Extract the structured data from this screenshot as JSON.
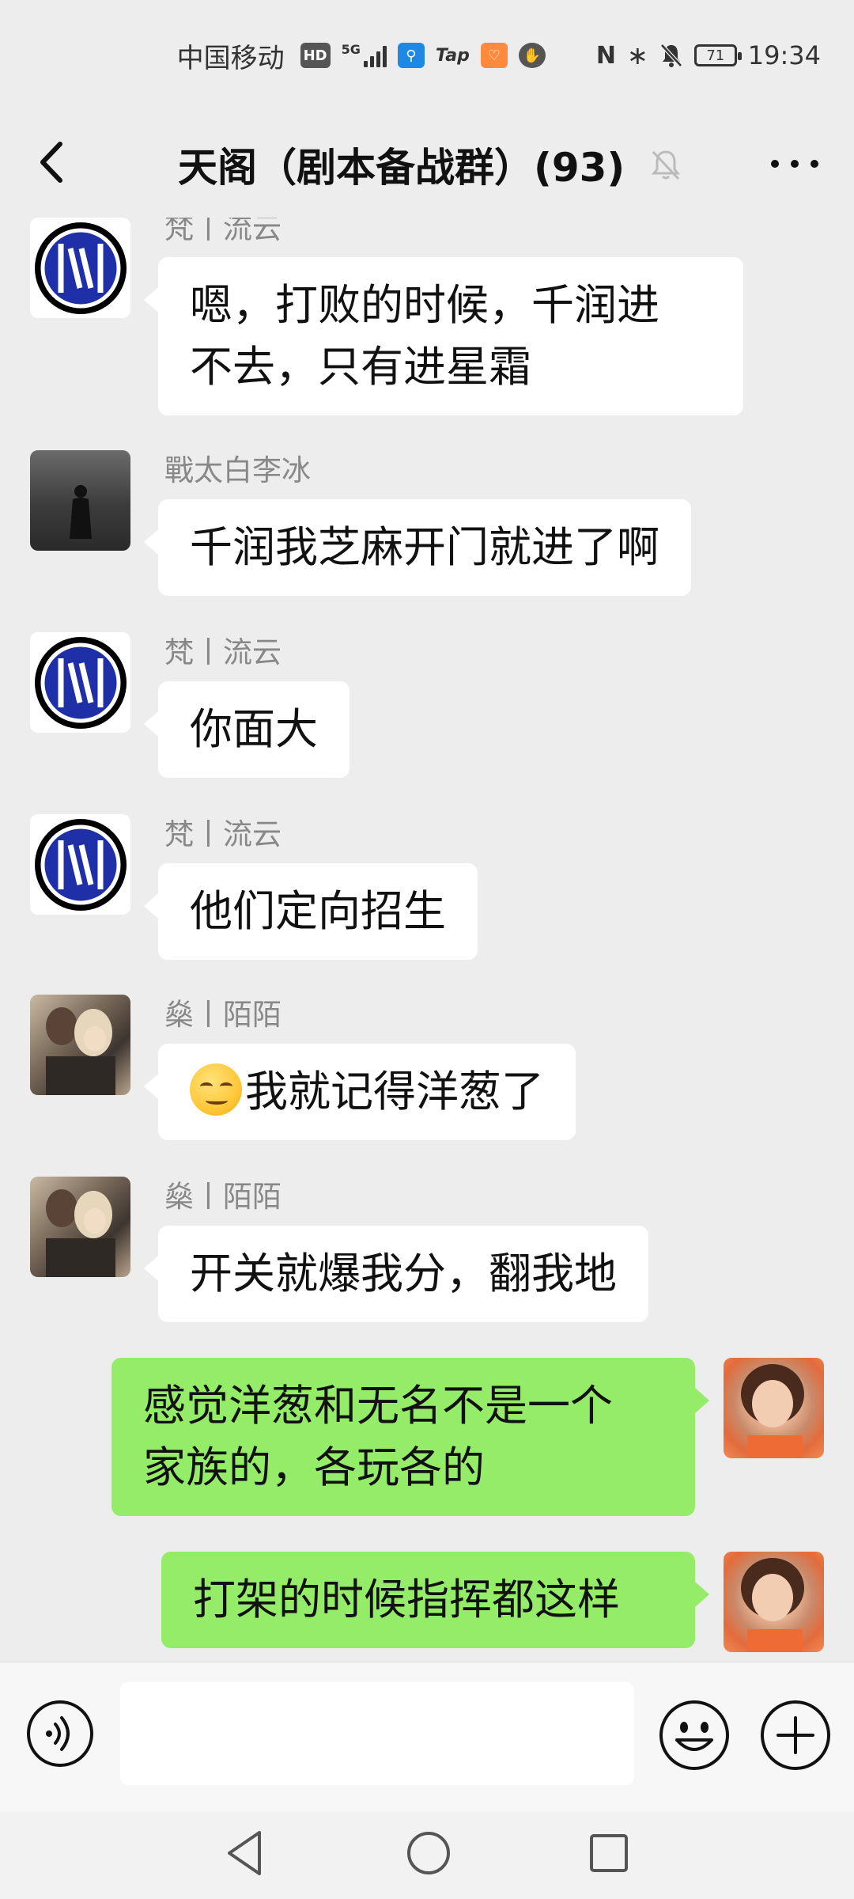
{
  "status_bar": {
    "carrier": "中国移动",
    "hd": "HD",
    "network": "5G",
    "tap": "Tap",
    "battery": "71",
    "time": "19:34"
  },
  "header": {
    "title": "天阁（剧本备战群）(93)"
  },
  "messages": [
    {
      "sender": "梵丨流云",
      "text_lines": [
        "嗯，打败的时候，千润进",
        "不去，只有进星霜"
      ]
    },
    {
      "sender": "戰太白李冰",
      "text_lines": [
        "千润我芝麻开门就进了啊"
      ]
    },
    {
      "sender": "梵丨流云",
      "text_lines": [
        "你面大"
      ]
    },
    {
      "sender": "梵丨流云",
      "text_lines": [
        "他们定向招生"
      ]
    },
    {
      "sender": "燊丨陌陌",
      "text_lines": [
        "我就记得洋葱了"
      ]
    },
    {
      "sender": "燊丨陌陌",
      "text_lines": [
        "开关就爆我分，翻我地"
      ]
    },
    {
      "sender": "",
      "text_lines": [
        "感觉洋葱和无名不是一个",
        "家族的，各玩各的"
      ]
    },
    {
      "sender": "",
      "text_lines": [
        "打架的时候指挥都这样"
      ]
    }
  ],
  "input": {
    "value": "",
    "placeholder": ""
  },
  "colors": {
    "background": "#ededed",
    "outgoing_bubble": "#95ec69",
    "incoming_bubble": "#ffffff"
  },
  "icons": {
    "back": "chevron-left-icon",
    "mute": "bell-off-icon",
    "more": "more-dots-icon",
    "voice": "voice-icon",
    "emoji": "smiley-icon",
    "plus": "plus-circle-icon"
  }
}
